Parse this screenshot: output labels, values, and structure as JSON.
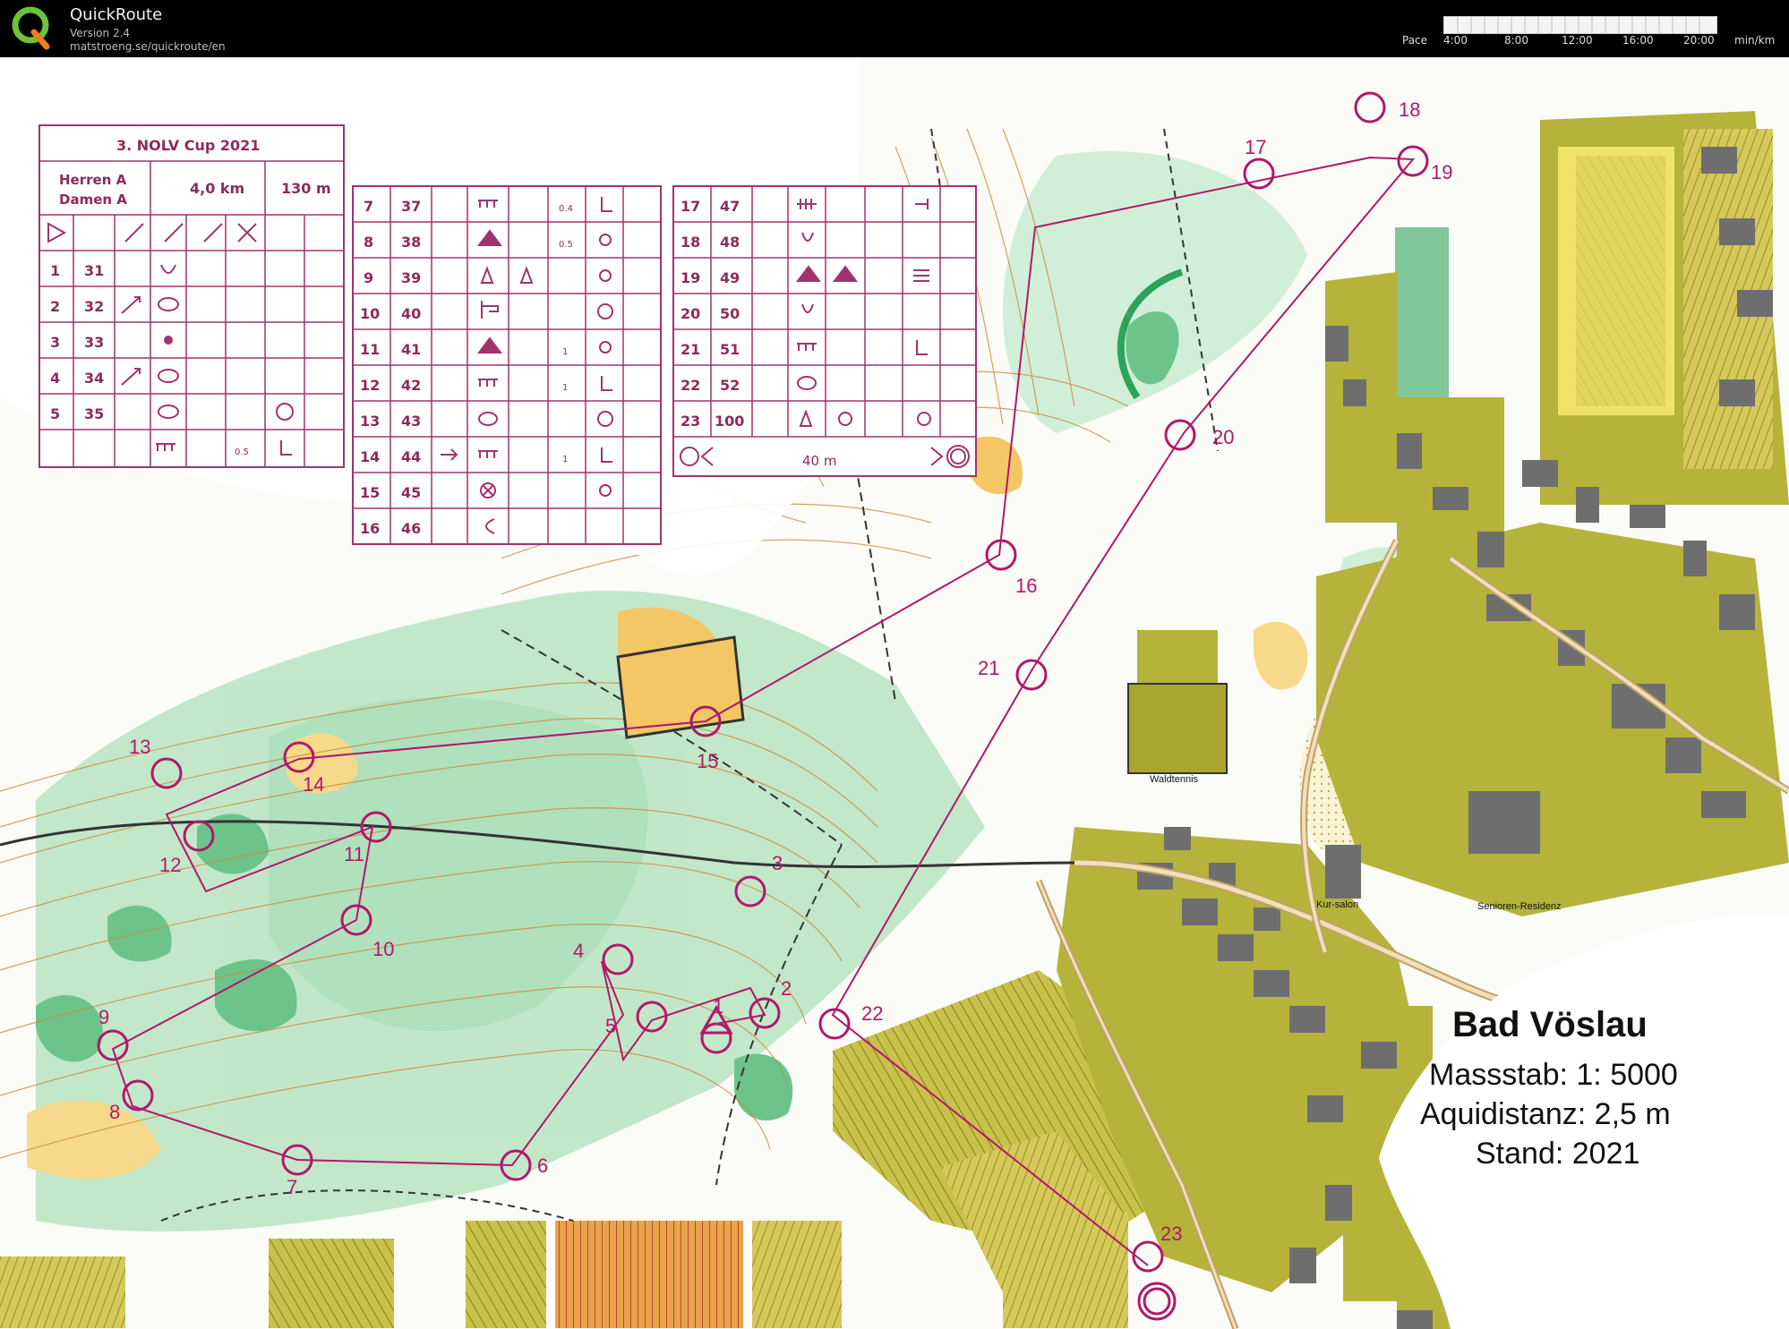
{
  "app": {
    "name": "QuickRoute",
    "version": "Version 2.4",
    "url": "matstroeng.se/quickroute/en",
    "logo_letter": "Q"
  },
  "pace_scale": {
    "label": "Pace",
    "ticks": [
      "4:00",
      "8:00",
      "12:00",
      "16:00",
      "20:00"
    ],
    "unit": "min/km"
  },
  "description_sheet": {
    "title": "3. NOLV Cup 2021",
    "class_line1": "Herren A",
    "class_line2": "Damen A",
    "length": "4,0 km",
    "climb": "130 m",
    "col1_rows": [
      {
        "n": "1",
        "code": "31"
      },
      {
        "n": "2",
        "code": "32"
      },
      {
        "n": "3",
        "code": "33"
      },
      {
        "n": "4",
        "code": "34"
      },
      {
        "n": "5",
        "code": "35"
      }
    ],
    "col2_rows": [
      {
        "n": "7",
        "code": "37"
      },
      {
        "n": "8",
        "code": "38"
      },
      {
        "n": "9",
        "code": "39"
      },
      {
        "n": "10",
        "code": "40"
      },
      {
        "n": "11",
        "code": "41"
      },
      {
        "n": "12",
        "code": "42"
      },
      {
        "n": "13",
        "code": "43"
      },
      {
        "n": "14",
        "code": "44"
      },
      {
        "n": "15",
        "code": "45"
      },
      {
        "n": "16",
        "code": "46"
      }
    ],
    "col3_rows": [
      {
        "n": "17",
        "code": "47"
      },
      {
        "n": "18",
        "code": "48"
      },
      {
        "n": "19",
        "code": "49"
      },
      {
        "n": "20",
        "code": "50"
      },
      {
        "n": "21",
        "code": "51"
      },
      {
        "n": "22",
        "code": "52"
      },
      {
        "n": "23",
        "code": "100"
      }
    ],
    "finish_distance": "40 m",
    "small_values": {
      "r7": "0.4",
      "r8": "0.5",
      "r12": "1",
      "r14": "1",
      "r11": "1",
      "r6": "0.5"
    }
  },
  "map_info": {
    "place": "Bad Vöslau",
    "scale": "Massstab: 1: 5000",
    "equidistance": "Aquidistanz: 2,5 m",
    "stand": "Stand: 2021",
    "label_waldtennis": "Waldtennis",
    "label_kurhalle": "Kur-salon",
    "label_senioren": "Senioren-Residenz"
  },
  "controls": [
    "1",
    "2",
    "3",
    "4",
    "5",
    "6",
    "7",
    "8",
    "9",
    "10",
    "11",
    "12",
    "13",
    "14",
    "15",
    "16",
    "17",
    "18",
    "19",
    "20",
    "21",
    "22",
    "23"
  ],
  "colors": {
    "course": "#b0186a",
    "open_land": "#f3c766",
    "forest_green": "#8fd3a8",
    "dark_green": "#2ea35a",
    "olive": "#a9a62f",
    "buildings": "#6e6e6e",
    "contours": "#c98a3a"
  }
}
